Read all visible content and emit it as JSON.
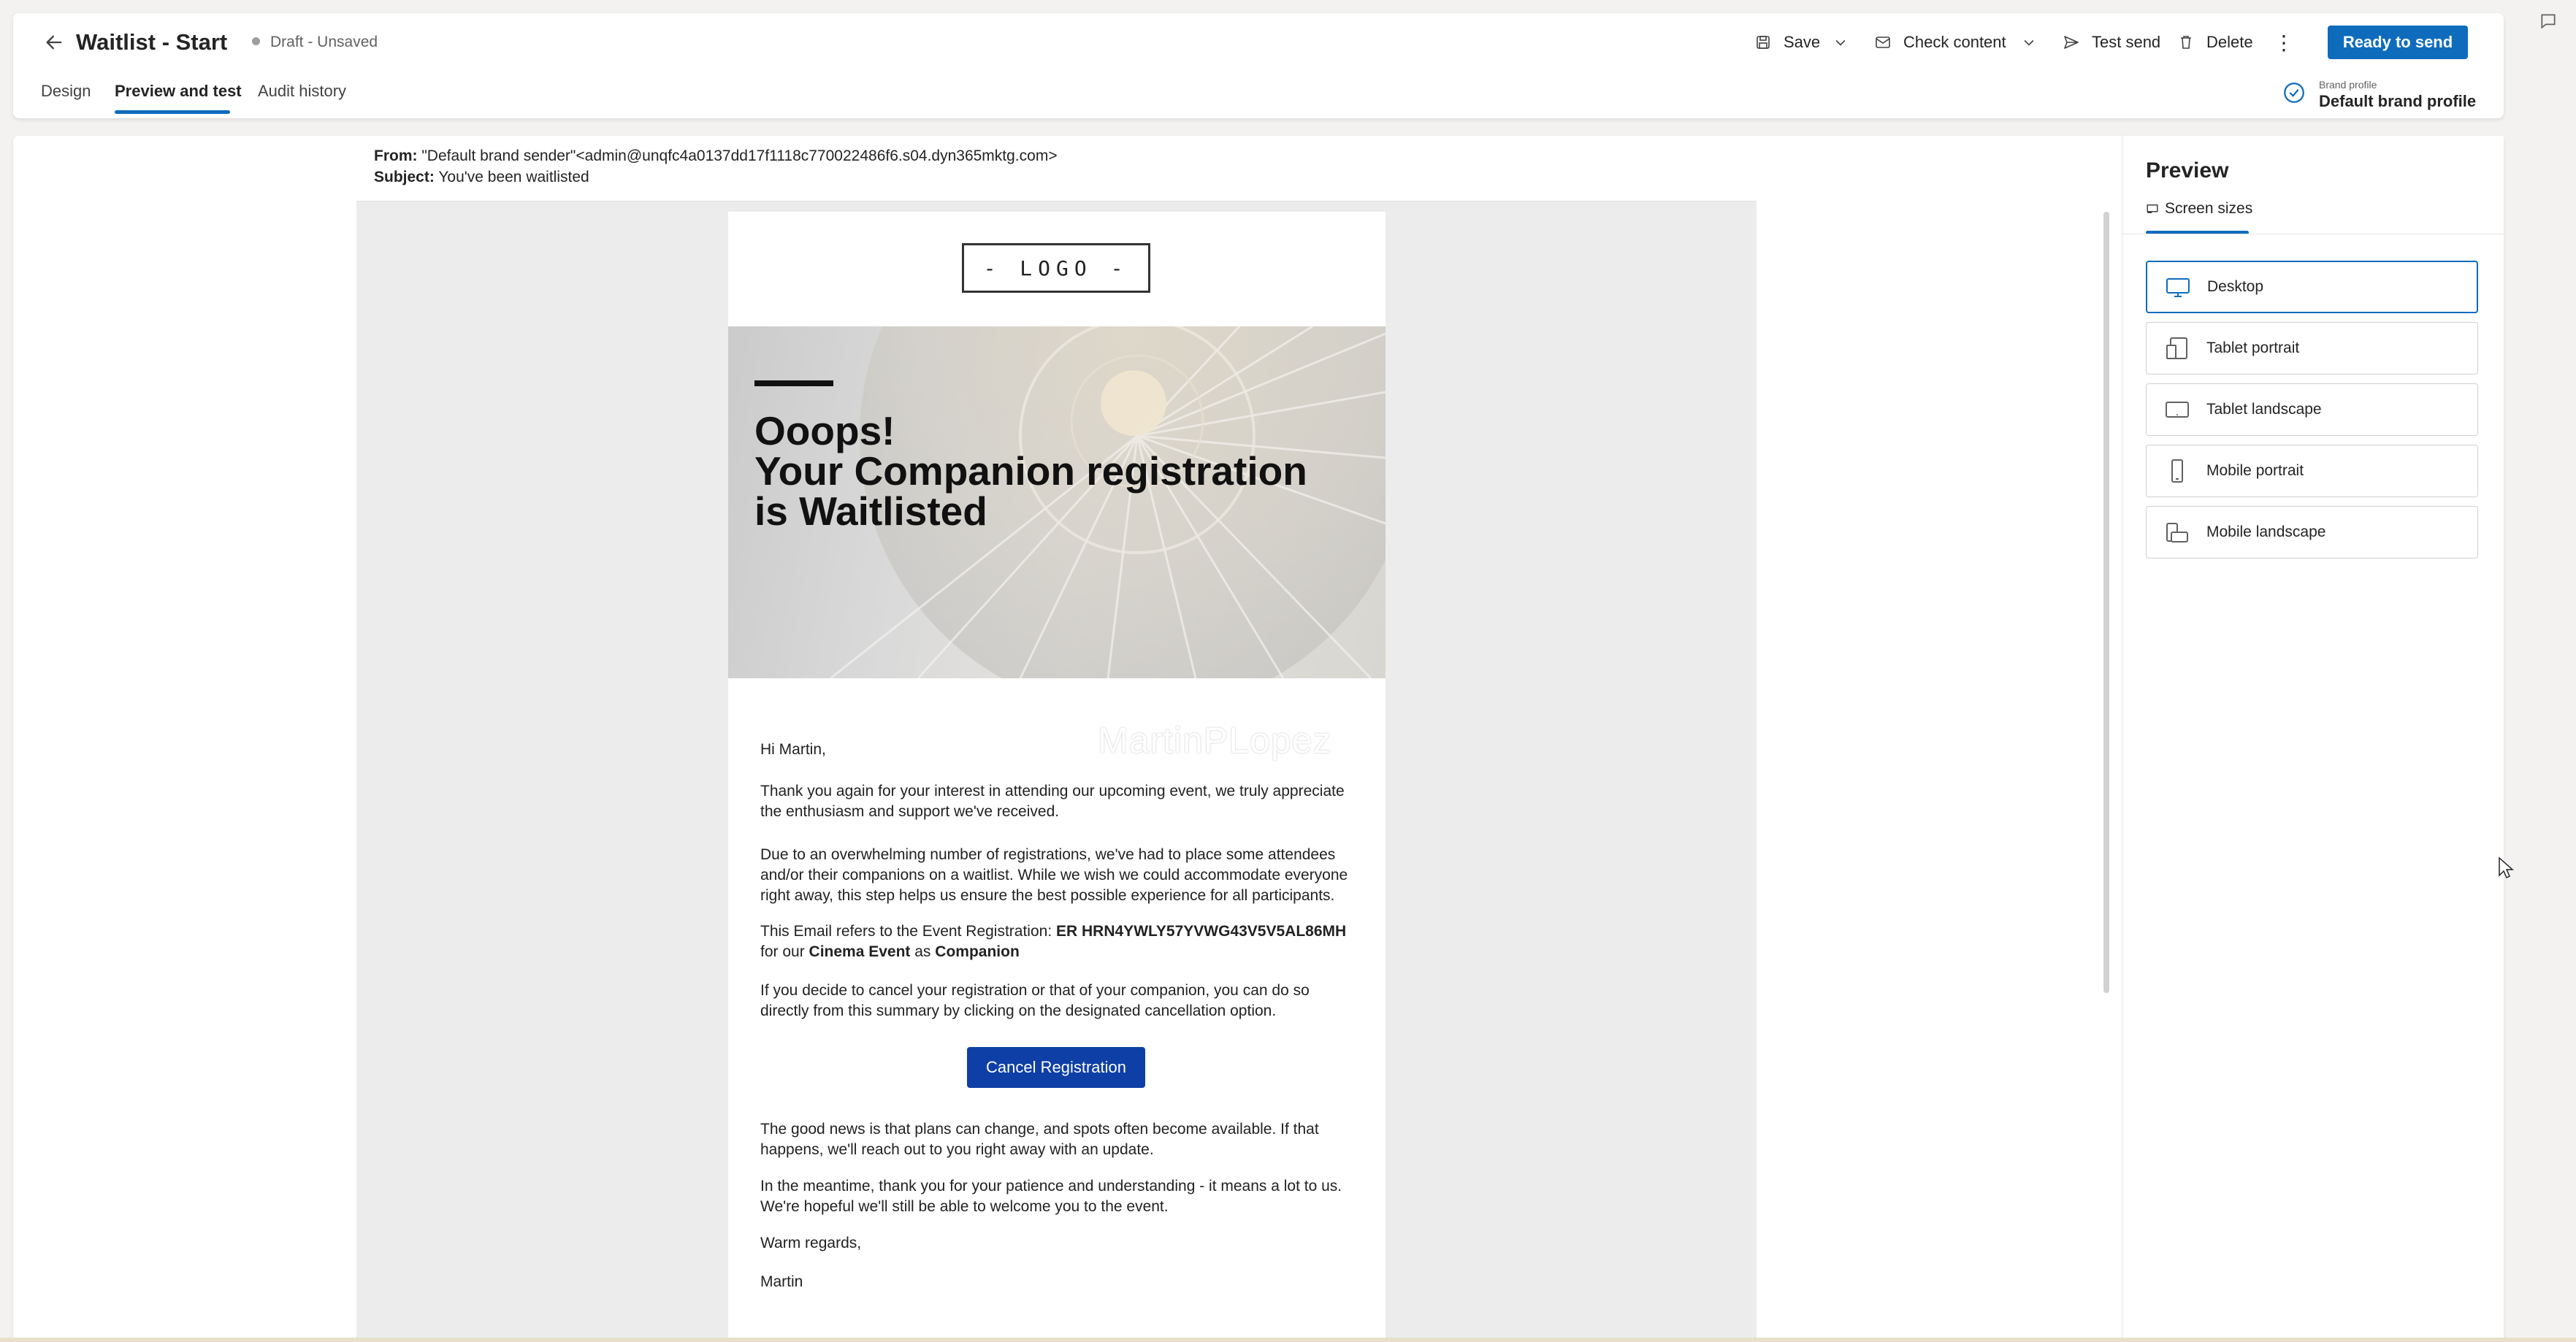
{
  "header": {
    "title": "Waitlist - Start",
    "status": "Draft - Unsaved",
    "toolbar": {
      "save_label": "Save",
      "check_label": "Check content",
      "test_send_label": "Test send",
      "delete_label": "Delete",
      "more_label": "⋮",
      "ready_label": "Ready to send"
    },
    "tabs": [
      {
        "label": "Design"
      },
      {
        "label": "Preview and test",
        "selected": true
      },
      {
        "label": "Audit history"
      }
    ],
    "brand_profile": {
      "caption": "Brand profile",
      "value": "Default brand profile"
    }
  },
  "email_header": {
    "from_key": "From:",
    "from_value": "\"Default brand sender\"<admin@unqfc4a0137dd17f1118c770022486f6.s04.dyn365mktg.com>",
    "subject_key": "Subject:",
    "subject_value": "You've been waitlisted"
  },
  "email": {
    "logo": "- LOGO -",
    "hero_lines": [
      "Ooops!",
      "Your Companion registration",
      "is Waitlisted"
    ],
    "watermark": "MartinPLopez",
    "greeting": "Hi Martin,",
    "thanks": "Thank you again for your interest in attending our upcoming event, we truly appreciate the enthusiasm and support we've received.",
    "due": "Due to an overwhelming number of registrations, we've had to place some attendees and/or their companions on a waitlist. While we wish we could accommodate everyone right away, this step helps us ensure the best possible experience for all participants.",
    "refers_prefix": "This Email refers to the Event Registration: ",
    "registration_id": "ER HRN4YWLY57YVWG43V5V5AL86MH",
    "for_our": "for our ",
    "event_name": "Cinema Event",
    "as": " as ",
    "role": "Companion",
    "cancel_info": "If you decide to cancel your registration or that of your companion, you can do so directly from this summary by clicking on the designated cancellation option.",
    "cancel_button": "Cancel Registration",
    "good_news": "The good news is that plans can change, and spots often become available. If that happens, we'll reach out to you right away with an update.",
    "meantime": "In the meantime, thank you for your patience and understanding - it means a lot to us. We're hopeful we'll still be able to welcome you to the event.",
    "regards": "Warm regards,",
    "signature": "Martin"
  },
  "preview_panel": {
    "title": "Preview",
    "tab_label": "Screen sizes",
    "options": [
      {
        "label": "Desktop",
        "icon": "desktop-icon",
        "selected": true
      },
      {
        "label": "Tablet portrait",
        "icon": "tablet-portrait-icon"
      },
      {
        "label": "Tablet landscape",
        "icon": "tablet-landscape-icon"
      },
      {
        "label": "Mobile portrait",
        "icon": "mobile-portrait-icon"
      },
      {
        "label": "Mobile landscape",
        "icon": "mobile-landscape-icon"
      }
    ]
  },
  "colors": {
    "accent": "#0f6cbd",
    "cancel_button": "#0e3fa6",
    "background": "#f3f2f1"
  }
}
